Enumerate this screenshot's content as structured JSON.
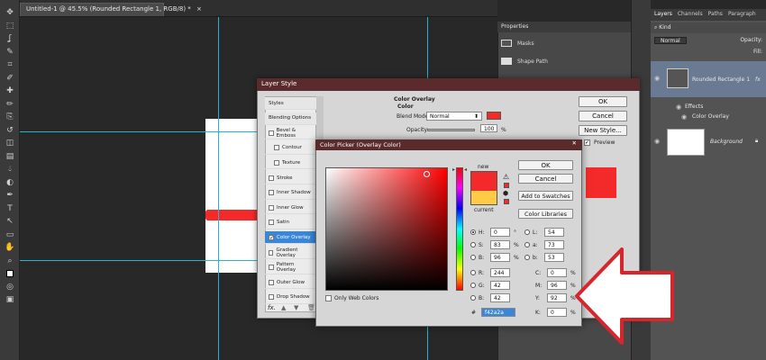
{
  "document": {
    "tab_title": "Untitled-1 @ 45.5% (Rounded Rectangle 1, RGB/8) *",
    "close_glyph": "×"
  },
  "toolbar": {
    "icons": [
      "move-tool",
      "marquee-tool",
      "lasso-tool",
      "quick-select-tool",
      "crop-tool",
      "eyedropper-tool",
      "healing-tool",
      "brush-tool",
      "clone-stamp-tool",
      "history-brush-tool",
      "eraser-tool",
      "gradient-tool",
      "blur-tool",
      "dodge-tool",
      "pen-tool",
      "type-tool",
      "path-select-tool",
      "shape-tool",
      "hand-tool",
      "zoom-tool",
      "foreground-background",
      "quick-mask",
      "screen-mode"
    ]
  },
  "properties": {
    "title": "Properties",
    "masks_label": "Masks",
    "shape_path_label": "Shape Path"
  },
  "layers_panel": {
    "tabs": [
      "Layers",
      "Channels",
      "Paths",
      "Paragraph"
    ],
    "kind_label": "Kind",
    "blend_mode": "Normal",
    "opacity_label": "Opacity:",
    "fill_label": "Fill:",
    "layers": [
      {
        "name": "Rounded Rectangle 1",
        "fx": "fx"
      },
      {
        "name": "Effects"
      },
      {
        "name": "Color Overlay"
      },
      {
        "name": "Background"
      }
    ]
  },
  "layer_style": {
    "title": "Layer Style",
    "list": [
      {
        "label": "Styles",
        "check": false,
        "head": true
      },
      {
        "label": "Blending Options",
        "check": false,
        "head": true
      },
      {
        "label": "Bevel & Emboss",
        "check": true,
        "checked": false
      },
      {
        "label": "Contour",
        "check": true,
        "checked": false,
        "indent": true
      },
      {
        "label": "Texture",
        "check": true,
        "checked": false,
        "indent": true
      },
      {
        "label": "Stroke",
        "check": true,
        "checked": false
      },
      {
        "label": "Inner Shadow",
        "check": true,
        "checked": false
      },
      {
        "label": "Inner Glow",
        "check": true,
        "checked": false
      },
      {
        "label": "Satin",
        "check": true,
        "checked": false
      },
      {
        "label": "Color Overlay",
        "check": true,
        "checked": true,
        "selected": true
      },
      {
        "label": "Gradient Overlay",
        "check": true,
        "checked": false
      },
      {
        "label": "Pattern Overlay",
        "check": true,
        "checked": false
      },
      {
        "label": "Outer Glow",
        "check": true,
        "checked": false
      },
      {
        "label": "Drop Shadow",
        "check": true,
        "checked": false
      }
    ],
    "section_title": "Color Overlay",
    "section_sub": "Color",
    "blend_mode_label": "Blend Mode:",
    "blend_mode_value": "Normal",
    "opacity_label": "Opacity:",
    "opacity_value": "100",
    "percent": "%",
    "ok": "OK",
    "cancel": "Cancel",
    "new_style": "New Style...",
    "preview_label": "Preview",
    "fx_label": "fx."
  },
  "color_picker": {
    "title": "Color Picker (Overlay Color)",
    "ok": "OK",
    "cancel": "Cancel",
    "add_to_swatches": "Add to Swatches",
    "color_libraries": "Color Libraries",
    "new_label": "new",
    "current_label": "current",
    "only_web_colors": "Only Web Colors",
    "fields_left": [
      {
        "label": "H:",
        "value": "0",
        "unit": "°",
        "on": true
      },
      {
        "label": "S:",
        "value": "83",
        "unit": "%"
      },
      {
        "label": "B:",
        "value": "96",
        "unit": "%"
      },
      {
        "label": "R:",
        "value": "244",
        "unit": ""
      },
      {
        "label": "G:",
        "value": "42",
        "unit": ""
      },
      {
        "label": "B:",
        "value": "42",
        "unit": ""
      }
    ],
    "fields_right": [
      {
        "label": "L:",
        "value": "54",
        "unit": ""
      },
      {
        "label": "a:",
        "value": "73",
        "unit": ""
      },
      {
        "label": "b:",
        "value": "53",
        "unit": ""
      }
    ],
    "cmyk": [
      {
        "label": "C:",
        "value": "0",
        "unit": "%"
      },
      {
        "label": "M:",
        "value": "96",
        "unit": "%"
      },
      {
        "label": "Y:",
        "value": "92",
        "unit": "%"
      },
      {
        "label": "K:",
        "value": "0",
        "unit": "%"
      }
    ],
    "hex_label": "#",
    "hex_value": "f42a2a",
    "new_color": "#f42a2a",
    "current_color": "#ffcb45"
  },
  "colors": {
    "accent_red": "#f42a2a",
    "dialog_title": "#5b2a2a",
    "guide": "#27b3d6",
    "arrow_stroke": "#d6262c"
  }
}
